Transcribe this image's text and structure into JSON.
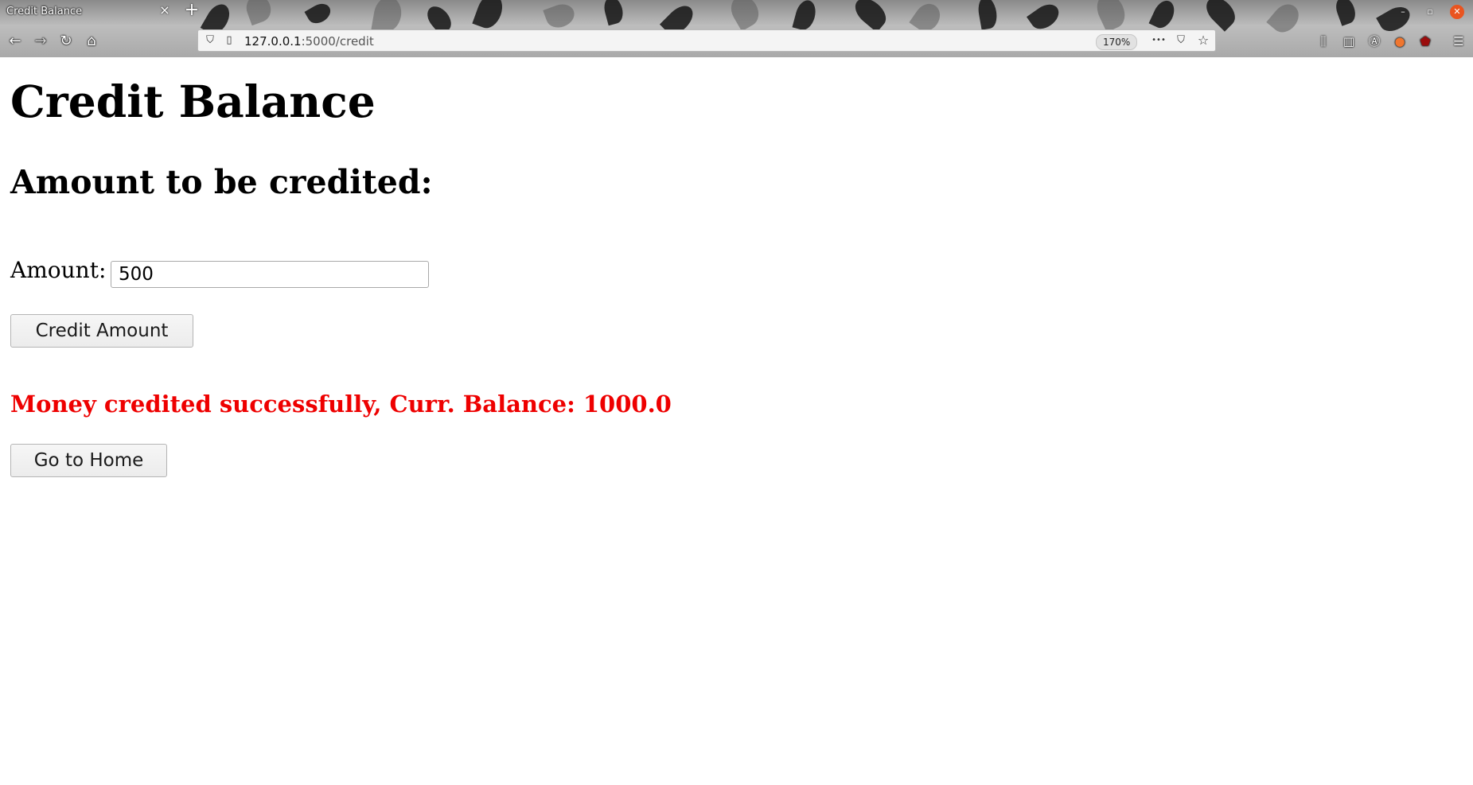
{
  "browser": {
    "tab_title": "Credit Balance",
    "tab_close_icon": "×",
    "new_tab_icon": "+",
    "url_host": "127.0.0.1",
    "url_path": ":5000/credit",
    "zoom": "170%",
    "menu_dots": "•••",
    "hamburger": "☰"
  },
  "page": {
    "title": "Credit Balance",
    "subtitle": "Amount to be credited:",
    "amount_label": "Amount:",
    "amount_value": "500",
    "credit_button": "Credit Amount",
    "success_message": "Money credited successfully, Curr. Balance: 1000.0",
    "home_button": "Go to Home"
  },
  "colors": {
    "success_text": "#ee0000",
    "window_close": "#e9541f"
  }
}
